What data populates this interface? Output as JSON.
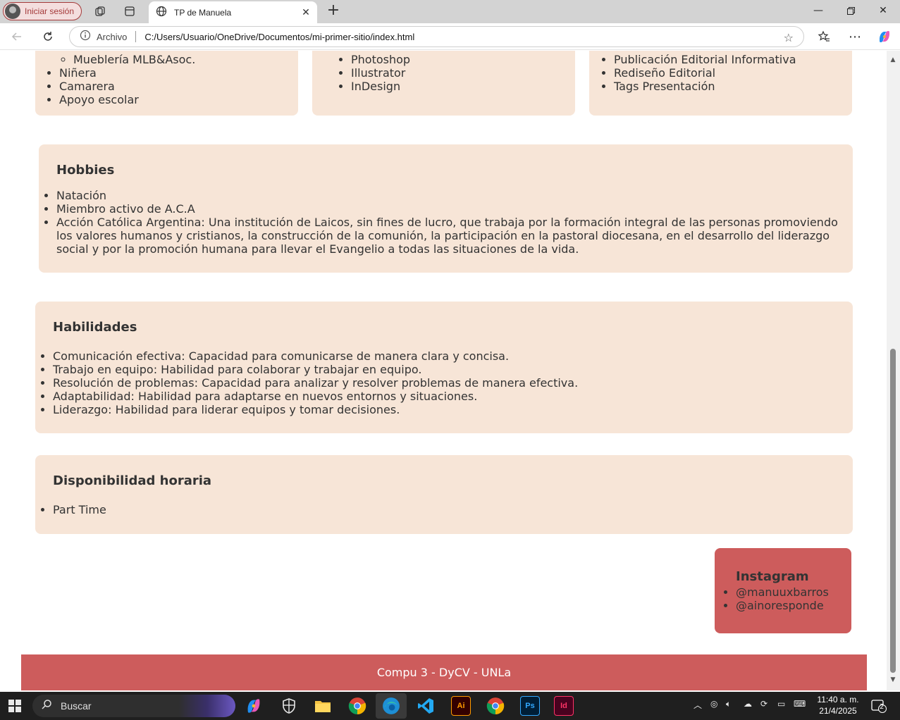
{
  "browser": {
    "profile_label": "Iniciar sesión",
    "tab_title": "TP de Manuela",
    "info_label": "Archivo",
    "url": "C:/Users/Usuario/OneDrive/Documentos/mi-primer-sitio/index.html"
  },
  "page": {
    "top_cards": [
      {
        "items": [
          "Mueblería MLB&Asoc.",
          "Niñera",
          "Camarera",
          "Apoyo escolar"
        ]
      },
      {
        "items": [
          "Photoshop",
          "Illustrator",
          "InDesign"
        ]
      },
      {
        "items": [
          "Publicación Editorial Informativa",
          "Rediseño Editorial",
          "Tags Presentación"
        ]
      }
    ],
    "hobbies": {
      "title": "Hobbies",
      "items": [
        "Natación",
        "Miembro activo de A.C.A",
        "Acción Católica Argentina: Una institución de Laicos, sin fines de lucro, que trabaja por la formación integral de las personas promoviendo los valores humanos y cristianos, la construcción de la comunión, la participación en la pastoral diocesana, en el desarrollo del liderazgo social y por la promoción humana para llevar el Evangelio a todas las situaciones de la vida."
      ]
    },
    "habilidades": {
      "title": "Habilidades",
      "items": [
        "Comunicación efectiva: Capacidad para comunicarse de manera clara y concisa.",
        "Trabajo en equipo: Habilidad para colaborar y trabajar en equipo.",
        "Resolución de problemas: Capacidad para analizar y resolver problemas de manera efectiva.",
        "Adaptabilidad: Habilidad para adaptarse en nuevos entornos y situaciones.",
        "Liderazgo: Habilidad para liderar equipos y tomar decisiones."
      ]
    },
    "disponibilidad": {
      "title": "Disponibilidad horaria",
      "items": [
        "Part Time"
      ]
    },
    "instagram": {
      "title": "Instagram",
      "items": [
        "@manuuxbarros",
        "@ainoresponde"
      ]
    },
    "footer": "Compu 3 - DyCV - UNLa",
    "colors": {
      "card_bg": "#f7e5d7",
      "accent": "#cd5c5c",
      "text": "#333333"
    }
  },
  "taskbar": {
    "search_label": "Buscar",
    "apps": [
      "copilot-icon",
      "defender-icon",
      "file-explorer-icon",
      "chrome-profile-icon",
      "edge-icon",
      "vscode-icon",
      "illustrator-icon",
      "chrome-icon",
      "photoshop-icon",
      "indesign-icon"
    ],
    "illustrator_label": "Ai",
    "photoshop_label": "Ps",
    "indesign_label": "Id",
    "time": "11:40 a. m.",
    "date": "21/4/2025",
    "notifications": "2"
  }
}
